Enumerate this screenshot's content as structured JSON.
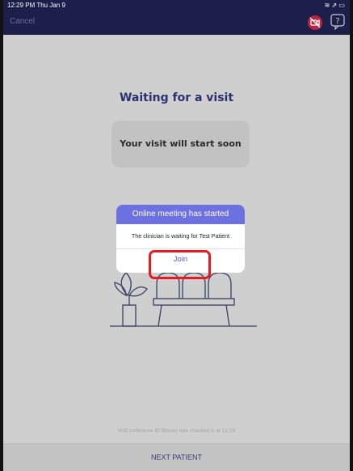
{
  "status_bar": {
    "time": "12:29 PM  Thu Jan 9",
    "indicators": "≋ ⇗ ▭"
  },
  "nav": {
    "cancel_label": "Cancel",
    "camera_icon": "camera-off-icon",
    "help_icon": "help-icon",
    "camera_color": "#b9253c"
  },
  "main": {
    "title": "Waiting for a visit",
    "card_text": "Your visit will start soon",
    "checkin_note": "Visit (reference ID 8base) was checked in at 12:29"
  },
  "dialog": {
    "title": "Online meeting has started",
    "message": "The clinician is waiting for Test Patient",
    "join_label": "Join",
    "header_color": "#6d70e0"
  },
  "footer": {
    "next_label": "NEXT PATIENT"
  },
  "highlight_color": "#e31b23"
}
